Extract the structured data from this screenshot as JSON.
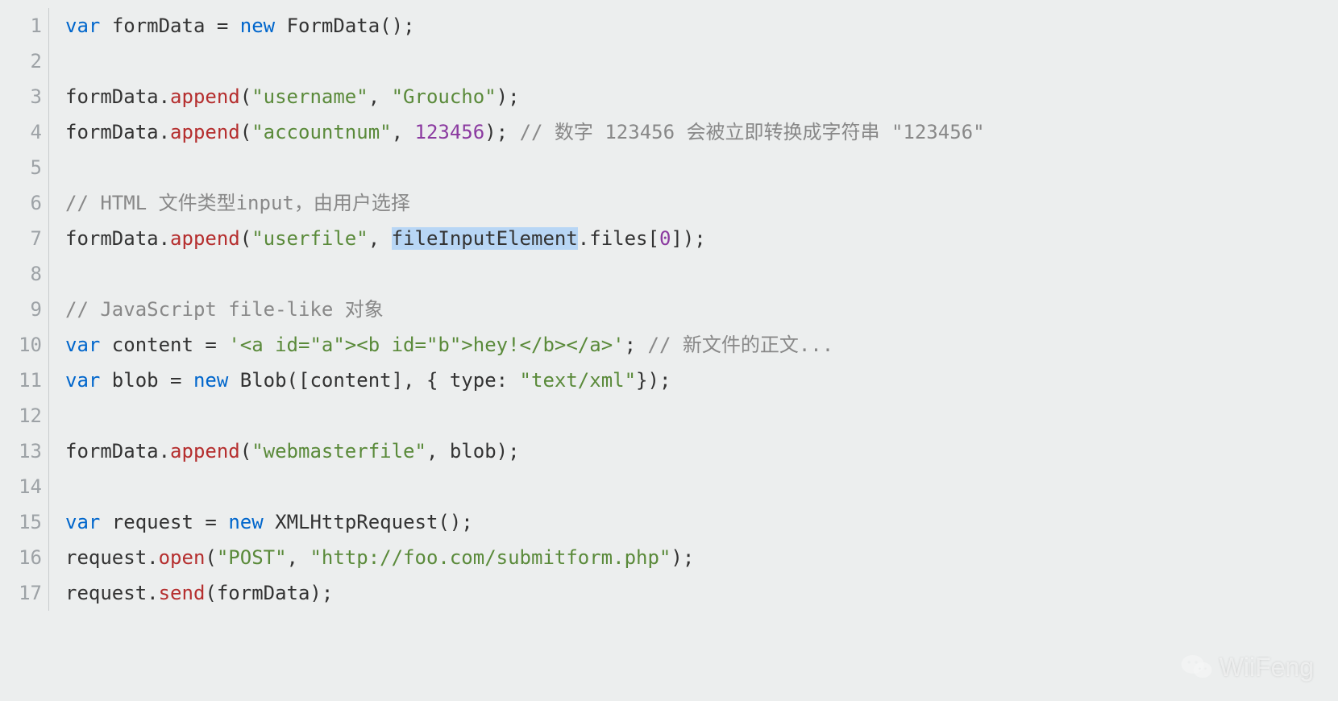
{
  "gutter": [
    "1",
    "2",
    "3",
    "4",
    "5",
    "6",
    "7",
    "8",
    "9",
    "10",
    "11",
    "12",
    "13",
    "14",
    "15",
    "16",
    "17"
  ],
  "code": {
    "l1": {
      "var": "var",
      "name": "formData",
      "eq": " = ",
      "new": "new",
      "ctor": " FormData",
      "paren": "();"
    },
    "l3": {
      "obj": "formData.",
      "m": "append",
      "open": "(",
      "s1": "\"username\"",
      "comma": ", ",
      "s2": "\"Groucho\"",
      "close": ");"
    },
    "l4": {
      "obj": "formData.",
      "m": "append",
      "open": "(",
      "s1": "\"accountnum\"",
      "comma": ", ",
      "n": "123456",
      "close": "); ",
      "cmt": "// 数字 123456 会被立即转换成字符串 \"123456\""
    },
    "l6": {
      "cmt": "// HTML 文件类型input，由用户选择"
    },
    "l7": {
      "obj": "formData.",
      "m": "append",
      "open": "(",
      "s1": "\"userfile\"",
      "comma": ", ",
      "sel": "fileInputElement",
      "rest": ".files[",
      "idx": "0",
      "close": "]);"
    },
    "l9": {
      "cmt": "// JavaScript file-like 对象"
    },
    "l10": {
      "var": "var",
      "name": " content = ",
      "s": "'<a id=\"a\"><b id=\"b\">hey!</b></a>'",
      "semi": "; ",
      "cmt": "// 新文件的正文..."
    },
    "l11": {
      "var": "var",
      "name": " blob = ",
      "new": "new",
      "ctor": " Blob([content], { type: ",
      "s": "\"text/xml\"",
      "close": "});"
    },
    "l13": {
      "obj": "formData.",
      "m": "append",
      "open": "(",
      "s1": "\"webmasterfile\"",
      "comma": ", blob);"
    },
    "l15": {
      "var": "var",
      "name": " request = ",
      "new": "new",
      "ctor": " XMLHttpRequest();"
    },
    "l16": {
      "obj": "request.",
      "m": "open",
      "open": "(",
      "s1": "\"POST\"",
      "comma": ", ",
      "s2": "\"http://foo.com/submitform.php\"",
      "close": ");"
    },
    "l17": {
      "obj": "request.",
      "m": "send",
      "open": "(formData);"
    }
  },
  "watermark": {
    "text": "WiiFeng"
  }
}
